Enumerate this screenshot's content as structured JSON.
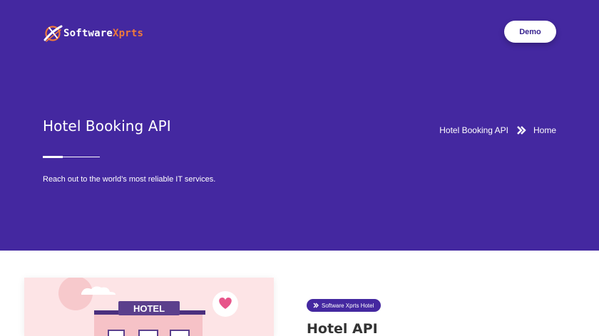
{
  "header": {
    "logo": {
      "name_part1": "Software",
      "name_part2": "Xprts",
      "icon": "swoosh-logo-icon"
    },
    "demo_button": "Demo"
  },
  "hero": {
    "title": "Hotel Booking API",
    "subtitle": "Reach out to the world’s most reliable IT services.",
    "breadcrumb": {
      "current": "Hotel Booking API",
      "separator_icon": "double-chevron-right-icon",
      "home": "Home"
    }
  },
  "content": {
    "illustration": {
      "sign_text": "HOTEL",
      "icon": "heart-icon"
    },
    "tag": {
      "icon": "double-chevron-right-icon",
      "label": "Software Xprts Hotel"
    },
    "title": "Hotel API"
  },
  "colors": {
    "hero_bg": "#4428a0",
    "accent_orange": "#f07a3a",
    "illustration_bg": "#fde4e6",
    "heart_pink": "#e7558a",
    "hotel_sign": "#5b3f8c"
  }
}
